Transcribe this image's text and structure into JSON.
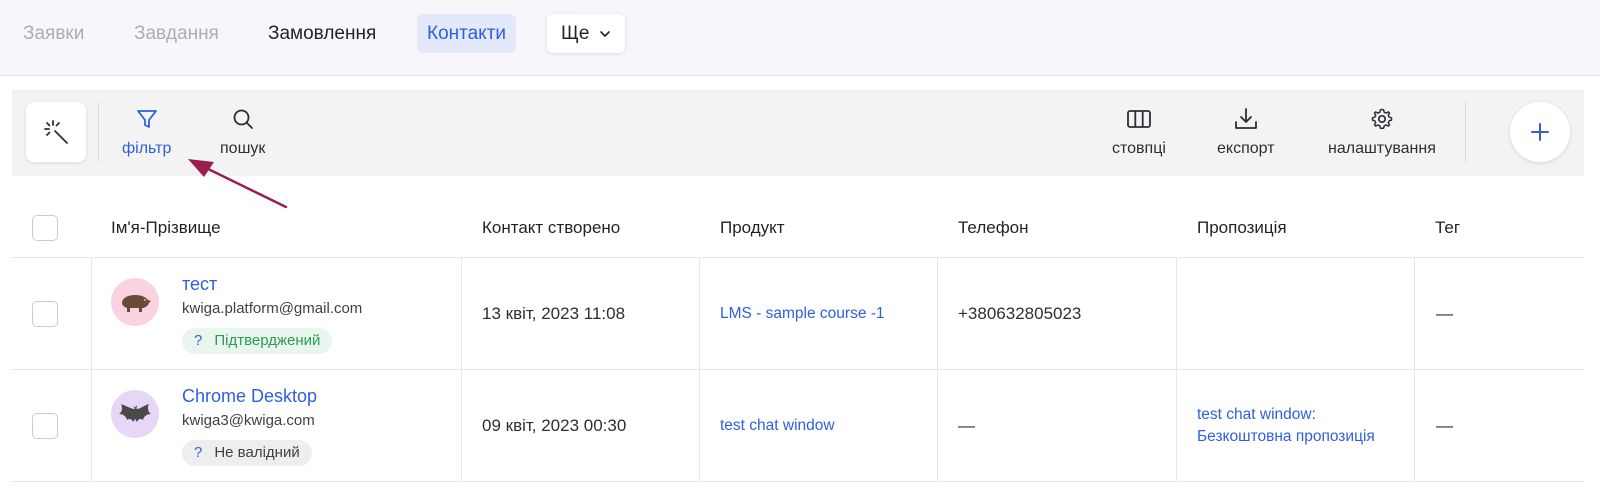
{
  "tabs": [
    {
      "label": "Заявки",
      "state": "muted"
    },
    {
      "label": "Завдання",
      "state": "muted"
    },
    {
      "label": "Замовлення",
      "state": "normal"
    },
    {
      "label": "Контакти",
      "state": "active"
    },
    {
      "label": "Ще",
      "state": "dropdown"
    }
  ],
  "toolbar": {
    "magic_icon": "magic-wand-icon",
    "filter": {
      "label": "фільтр",
      "icon": "filter-icon",
      "active": true
    },
    "search": {
      "label": "пошук",
      "icon": "search-icon"
    },
    "columns": {
      "label": "стовпці",
      "icon": "columns-icon"
    },
    "export": {
      "label": "експорт",
      "icon": "download-icon"
    },
    "settings": {
      "label": "налаштування",
      "icon": "gear-icon"
    },
    "add_icon": "plus-icon"
  },
  "table": {
    "headers": [
      "Ім'я-Прізвище",
      "Контакт створено",
      "Продукт",
      "Телефон",
      "Пропозиція",
      "Тег"
    ],
    "rows": [
      {
        "name": "тест",
        "email": "kwiga.platform@gmail.com",
        "status_mark": "?",
        "status": "Підтверджений",
        "created": "13 квіт, 2023 11:08",
        "product": "LMS - sample course -1",
        "phone": "+380632805023",
        "offer_line1": "",
        "offer_line2": "",
        "tag": "—",
        "avatar_icon": "boar-avatar-icon"
      },
      {
        "name": "Chrome Desktop",
        "email": "kwiga3@kwiga.com",
        "status_mark": "?",
        "status": "Не валідний",
        "created": "09 квіт, 2023 00:30",
        "product": "test chat window",
        "phone": "—",
        "offer_line1": "test chat window:",
        "offer_line2": "Безкоштовна пропозиція",
        "tag": "—",
        "avatar_icon": "bat-avatar-icon"
      }
    ]
  },
  "colors": {
    "accent": "#2f5fe0",
    "active_tab_bg": "#e3e8fa",
    "confirmed_badge": "#2e9a55",
    "annotation_arrow": "#9b1c4e"
  }
}
